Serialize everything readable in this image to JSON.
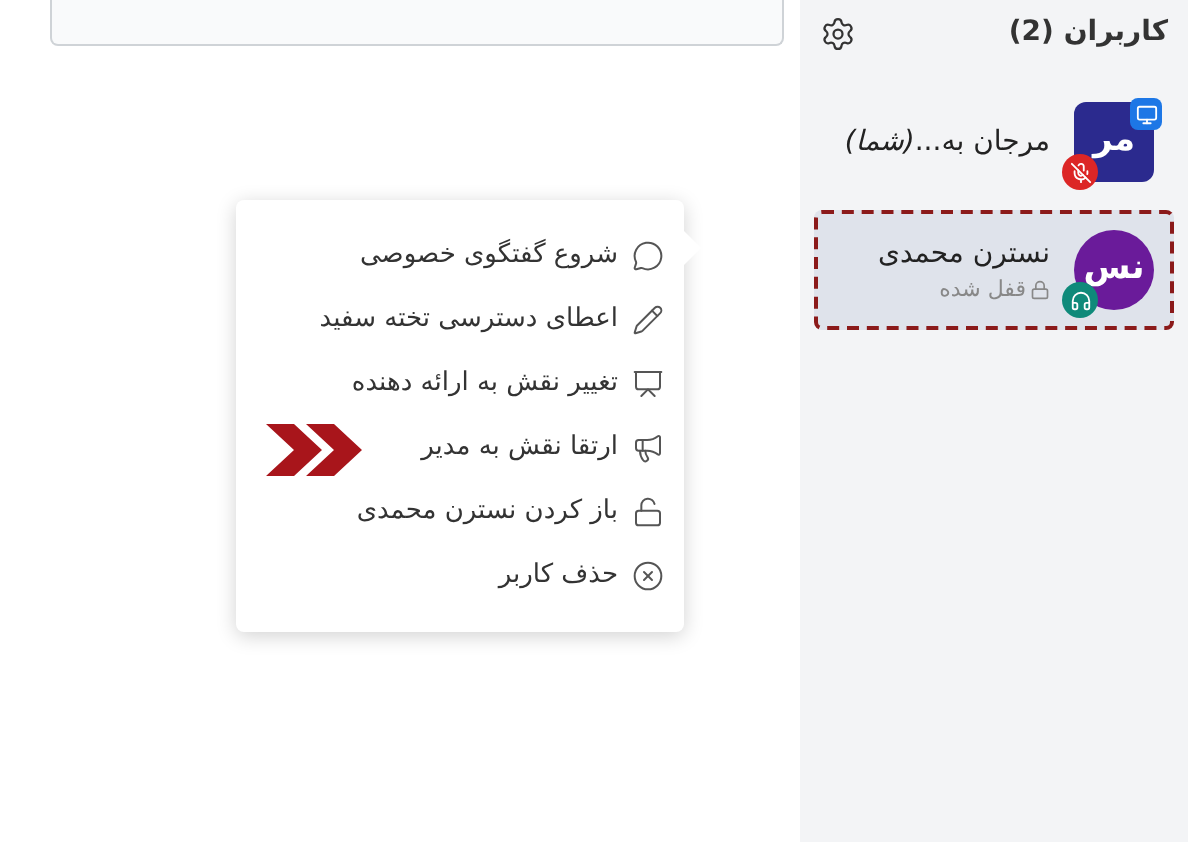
{
  "sidebar": {
    "title": "کاربران (2)",
    "users": [
      {
        "initials": "مر",
        "name": "مرجان به...",
        "you_label": "(شما)",
        "kind": "square",
        "color": "#2b2a8e",
        "presenter": true,
        "muted": true,
        "listen_only": false,
        "selected": false
      },
      {
        "initials": "نس",
        "name": "نسترن محمدی",
        "status": "قفل شده",
        "kind": "circle",
        "color": "#6a1b9a",
        "presenter": false,
        "muted": false,
        "listen_only": true,
        "selected": true
      }
    ]
  },
  "menu": {
    "items": [
      {
        "kind": "chat",
        "label": "شروع گفتگوی خصوصی",
        "pointed": false
      },
      {
        "kind": "pencil",
        "label": "اعطای دسترسی تخته سفید",
        "pointed": false
      },
      {
        "kind": "presenter",
        "label": "تغییر نقش به ارائه دهنده",
        "pointed": false
      },
      {
        "kind": "megaphone",
        "label": "ارتقا نقش به مدیر",
        "pointed": true
      },
      {
        "kind": "unlock",
        "label": "باز کردن نسترن محمدی",
        "pointed": false
      },
      {
        "kind": "remove",
        "label": "حذف کاربر",
        "pointed": false
      }
    ]
  }
}
